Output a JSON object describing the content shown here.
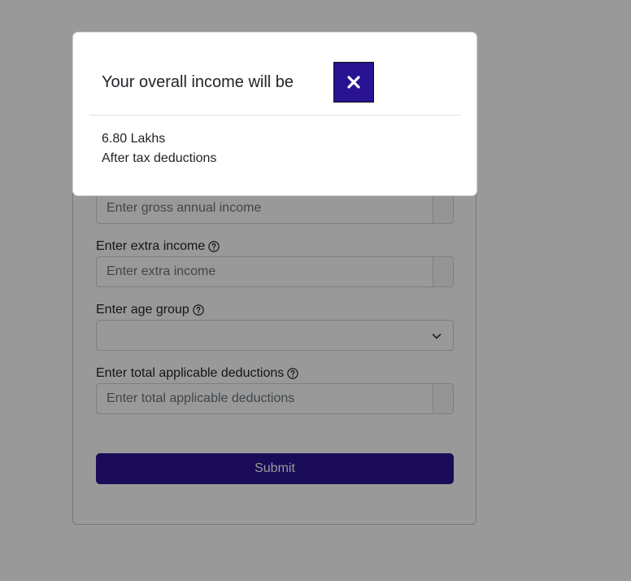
{
  "form": {
    "gross_income": {
      "placeholder": "Enter gross annual income",
      "value": ""
    },
    "extra_income": {
      "label": "Enter extra income",
      "placeholder": "Enter extra income",
      "value": ""
    },
    "age_group": {
      "label": "Enter age group",
      "selected": ""
    },
    "deductions": {
      "label": "Enter total applicable deductions",
      "placeholder": "Enter total applicable deductions",
      "value": ""
    },
    "submit_label": "Submit"
  },
  "modal": {
    "title": "Your overall income will be",
    "amount": "6.80 Lakhs",
    "note": "After tax deductions"
  },
  "icons": {
    "help": "help-circle-icon",
    "chevron": "chevron-down-icon",
    "close": "close-icon"
  },
  "colors": {
    "primary": "#2a1393",
    "backdrop": "rgba(0,0,0,0.4)"
  }
}
